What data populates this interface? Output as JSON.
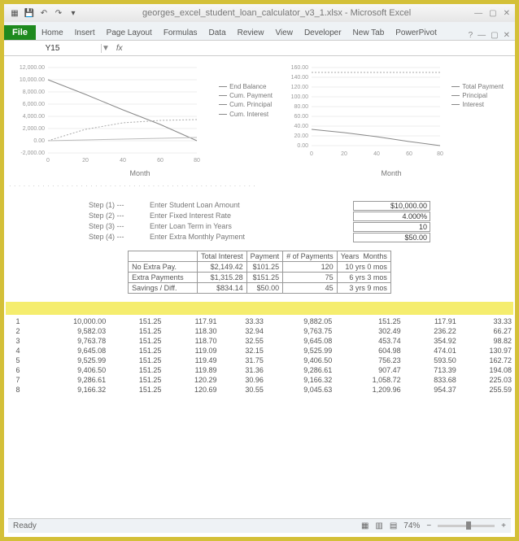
{
  "window": {
    "title": "georges_excel_student_loan_calculator_v3_1.xlsx - Microsoft Excel",
    "qat": {
      "save": "💾",
      "undo": "↶",
      "redo": "↷",
      "more": "▾"
    },
    "controls": {
      "min": "—",
      "max": "▢",
      "close": "✕"
    }
  },
  "ribbon": {
    "file": "File",
    "tabs": [
      "Home",
      "Insert",
      "Page Layout",
      "Formulas",
      "Data",
      "Review",
      "View",
      "Developer",
      "New Tab",
      "PowerPivot"
    ]
  },
  "formula": {
    "name_box": "Y15",
    "dropdown": "▼",
    "fx": "fx"
  },
  "chart_data": [
    {
      "type": "line",
      "title": "",
      "xlabel": "Month",
      "ylabel": "",
      "x_ticks": [
        0,
        20,
        40,
        60,
        80
      ],
      "y_ticks": [
        -2000,
        0,
        2000,
        4000,
        6000,
        8000,
        10000,
        12000
      ],
      "y_tick_labels": [
        "-2,000.00",
        "0.00",
        "2,000.00",
        "4,000.00",
        "6,000.00",
        "8,000.00",
        "10,000.00",
        "12,000.00"
      ],
      "ylim": [
        -2000,
        12000
      ],
      "legend": [
        "End Balance",
        "Cum. Payment",
        "Cum. Principal",
        "Cum. Interest"
      ],
      "series": [
        {
          "name": "End Balance",
          "x": [
            0,
            20,
            40,
            60,
            80
          ],
          "y": [
            10000,
            7300,
            4600,
            1900,
            0
          ]
        },
        {
          "name": "Cum. Payment",
          "x": [
            0,
            20,
            40,
            60,
            80
          ],
          "y": [
            0,
            150,
            300,
            450,
            600
          ]
        },
        {
          "name": "Cum. Principal",
          "x": [
            0,
            20,
            40,
            60,
            80
          ],
          "y": [
            0,
            120,
            240,
            360,
            480
          ]
        },
        {
          "name": "Cum. Interest",
          "x": [
            0,
            20,
            40,
            60,
            80
          ],
          "y": [
            0,
            1900,
            3000,
            3400,
            3500
          ]
        }
      ]
    },
    {
      "type": "line",
      "title": "",
      "xlabel": "Month",
      "ylabel": "",
      "x_ticks": [
        0,
        20,
        40,
        60,
        80
      ],
      "y_ticks": [
        0,
        20,
        40,
        60,
        80,
        100,
        120,
        140,
        160
      ],
      "y_tick_labels": [
        "0.00",
        "20.00",
        "40.00",
        "60.00",
        "80.00",
        "100.00",
        "120.00",
        "140.00",
        "160.00"
      ],
      "ylim": [
        0,
        160
      ],
      "legend": [
        "Total Payment",
        "Principal",
        "Interest"
      ],
      "series": [
        {
          "name": "Total Payment",
          "x": [
            0,
            20,
            40,
            60,
            75
          ],
          "y": [
            150,
            150,
            150,
            150,
            150
          ]
        },
        {
          "name": "Principal",
          "x": [
            0,
            20,
            40,
            60,
            75
          ],
          "y": [
            118,
            125,
            134,
            143,
            150
          ]
        },
        {
          "name": "Interest",
          "x": [
            0,
            20,
            40,
            60,
            75
          ],
          "y": [
            33,
            26,
            17,
            8,
            1
          ]
        }
      ]
    }
  ],
  "steps": [
    {
      "label": "Step (1) ---",
      "desc": "Enter Student Loan Amount",
      "val": "$10,000.00"
    },
    {
      "label": "Step (2) ---",
      "desc": "Enter Fixed Interest Rate",
      "val": "4.000%"
    },
    {
      "label": "Step (3) ---",
      "desc": "Enter Loan Term in Years",
      "val": "10"
    },
    {
      "label": "Step (4) ---",
      "desc": "Enter Extra Monthly Payment",
      "val": "$50.00"
    }
  ],
  "summary": {
    "headers": [
      "",
      "Total Interest",
      "Payment",
      "# of Payments",
      "Years",
      "Months"
    ],
    "rows": [
      {
        "label": "No Extra Pay.",
        "cells": [
          "$2,149.42",
          "$101.25",
          "120",
          "10 yrs 0 mos"
        ]
      },
      {
        "label": "Extra Payments",
        "cells": [
          "$1,315.28",
          "$151.25",
          "75",
          "6 yrs 3 mos"
        ]
      },
      {
        "label": "Savings / Diff.",
        "cells": [
          "$834.14",
          "$50.00",
          "45",
          "3 yrs 9 mos"
        ]
      }
    ]
  },
  "amort": {
    "rows": [
      [
        "1",
        "10,000.00",
        "151.25",
        "117.91",
        "33.33",
        "9,882.05",
        "151.25",
        "117.91",
        "33.33"
      ],
      [
        "2",
        "9,582.03",
        "151.25",
        "118.30",
        "32.94",
        "9,763.75",
        "302.49",
        "236.22",
        "66.27"
      ],
      [
        "3",
        "9,763.78",
        "151.25",
        "118.70",
        "32.55",
        "9,645.08",
        "453.74",
        "354.92",
        "98.82"
      ],
      [
        "4",
        "9,645.08",
        "151.25",
        "119.09",
        "32.15",
        "9,525.99",
        "604.98",
        "474.01",
        "130.97"
      ],
      [
        "5",
        "9,525.99",
        "151.25",
        "119.49",
        "31.75",
        "9,406.50",
        "756.23",
        "593.50",
        "162.72"
      ],
      [
        "6",
        "9,406.50",
        "151.25",
        "119.89",
        "31.36",
        "9,286.61",
        "907.47",
        "713.39",
        "194.08"
      ],
      [
        "7",
        "9,286.61",
        "151.25",
        "120.29",
        "30.96",
        "9,166.32",
        "1,058.72",
        "833.68",
        "225.03"
      ],
      [
        "8",
        "9,166.32",
        "151.25",
        "120.69",
        "30.55",
        "9,045.63",
        "1,209.96",
        "954.37",
        "255.59"
      ]
    ]
  },
  "status": {
    "ready": "Ready",
    "zoom": "74%",
    "minus": "−",
    "plus": "+"
  }
}
